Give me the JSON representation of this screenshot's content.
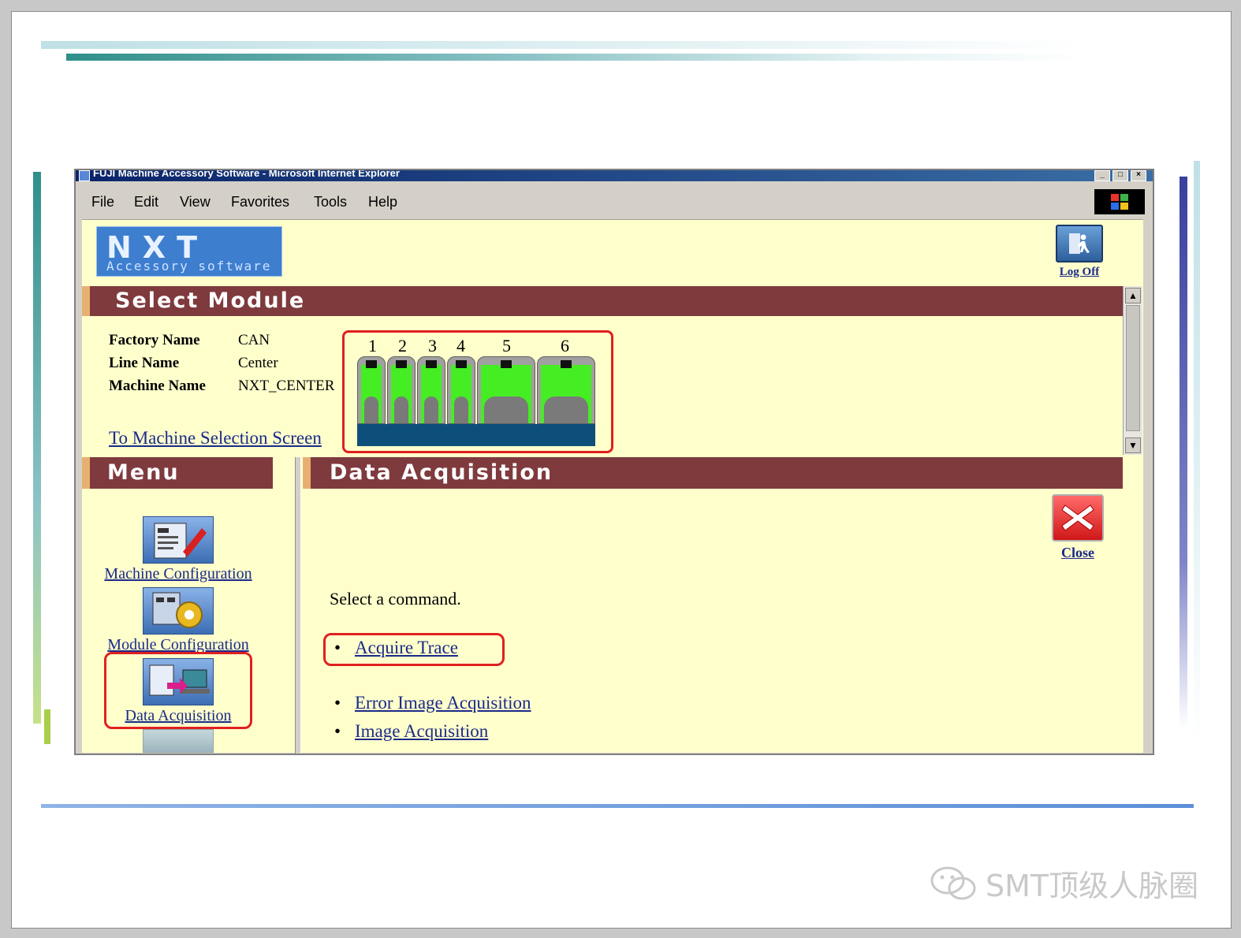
{
  "window": {
    "title": "FUJI Machine Accessory Software - Microsoft Internet Explorer",
    "controls": [
      "_",
      "□",
      "×"
    ]
  },
  "menubar": {
    "items": [
      "File",
      "Edit",
      "View",
      "Favorites",
      "Tools",
      "Help"
    ]
  },
  "logo": {
    "main": "NXT",
    "sub": "Accessory software"
  },
  "logoff": {
    "label": "Log Off"
  },
  "select_module": {
    "title": "Select Module",
    "fields": [
      {
        "label": "Factory Name",
        "value": "CAN"
      },
      {
        "label": "Line Name",
        "value": "Center"
      },
      {
        "label": "Machine Name",
        "value": "NXT_CENTER"
      }
    ],
    "to_machine_link": "To Machine Selection Screen",
    "modules": [
      "1",
      "2",
      "3",
      "4",
      "5",
      "6"
    ]
  },
  "menu": {
    "title": "Menu",
    "items": [
      {
        "label": "Machine Configuration"
      },
      {
        "label": "Module Configuration"
      },
      {
        "label": "Data Acquisition"
      }
    ]
  },
  "data_acquisition": {
    "title": "Data Acquisition",
    "close_label": "Close",
    "prompt": "Select a command.",
    "commands": [
      "Acquire Trace",
      "Error Image Acquisition",
      "Image Acquisition"
    ]
  },
  "watermark": {
    "text": "SMT顶级人脉圈"
  },
  "colors": {
    "band": "#7f3a3e",
    "panel": "#ffffcc",
    "highlight": "#e02020",
    "link": "#1a2a8a"
  }
}
